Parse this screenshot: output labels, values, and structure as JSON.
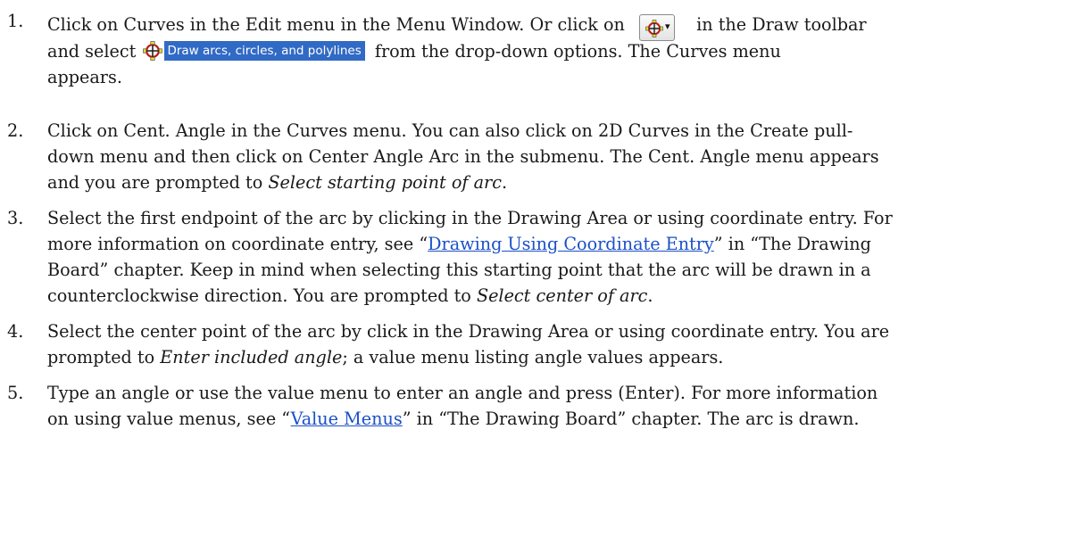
{
  "icons": {
    "arc_tool": "circle-crosshair-icon",
    "dropdown": "dropdown-arrow-icon"
  },
  "toolbar_button": {
    "arrow": "▾"
  },
  "dropdown_option": {
    "label": "Draw arcs, circles, and polylines"
  },
  "steps": [
    {
      "number": "1.",
      "l1a": "Click on Curves in the Edit menu in the Menu Window. Or click on",
      "l1b": "in the Draw toolbar",
      "l2a": "and select",
      "l2b": "from the drop-down options. The Curves menu",
      "l3": "appears."
    },
    {
      "number": "2.",
      "l1": "Click on Cent. Angle in the Curves menu. You can also click on 2D Curves in the Create pull-",
      "l2": "down menu and then click on Center Angle Arc in the submenu. The Cent. Angle menu appears",
      "l3a": "and you are prompted to ",
      "l3b": "Select starting point of arc",
      "l3c": "."
    },
    {
      "number": "3.",
      "l1": "Select the first endpoint of the arc by clicking in the Drawing Area or using coordinate entry. For",
      "l2a": "more information on coordinate entry, see “",
      "l2link": "Drawing Using Coordinate Entry",
      "l2b": "” in “The Drawing",
      "l3": "Board” chapter. Keep in mind when selecting this starting point that the arc will be drawn in a",
      "l4a": "counterclockwise direction. You are prompted to ",
      "l4b": "Select center of arc",
      "l4c": "."
    },
    {
      "number": "4.",
      "l1": "Select the center point of the arc by click in the Drawing Area or using coordinate entry. You are",
      "l2a": "prompted to ",
      "l2b": "Enter included angle",
      "l2c": "; a value menu listing angle values appears."
    },
    {
      "number": "5.",
      "l1": "Type an angle or use the value menu to enter an angle and press (Enter). For more information",
      "l2a": "on using value menus, see “",
      "l2link": "Value Menus",
      "l2b": "” in “The Drawing Board” chapter. The arc is drawn."
    }
  ]
}
